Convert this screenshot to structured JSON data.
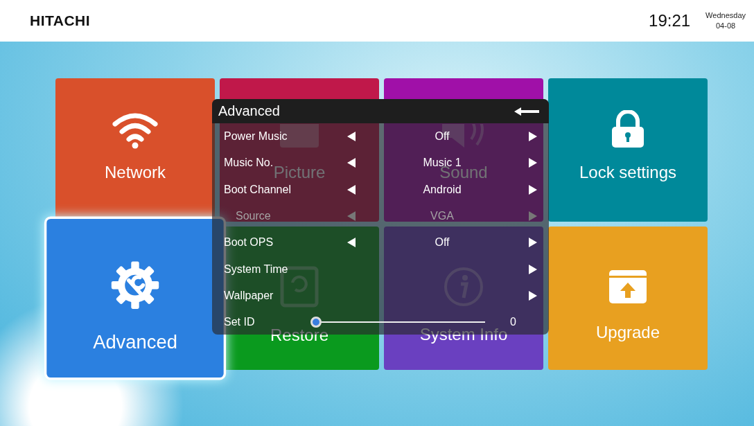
{
  "header": {
    "logo": "HITACHI",
    "time": "19:21",
    "weekday": "Wednesday",
    "date": "04-08"
  },
  "tiles": [
    {
      "label": "Network",
      "kind": "network",
      "color": "#d9502b",
      "selected": false
    },
    {
      "label": "Picture",
      "kind": "picture",
      "color": "#c0184a",
      "selected": false
    },
    {
      "label": "Sound",
      "kind": "sound",
      "color": "#a010a8",
      "selected": false
    },
    {
      "label": "Lock settings",
      "kind": "lock",
      "color": "#00899a",
      "selected": false
    },
    {
      "label": "Advanced",
      "kind": "advanced",
      "color": "#2b80e0",
      "selected": true
    },
    {
      "label": "Restore",
      "kind": "restore",
      "color": "#0a9a1e",
      "selected": false
    },
    {
      "label": "System Info",
      "kind": "info",
      "color": "#6a40c0",
      "selected": false
    },
    {
      "label": "Upgrade",
      "kind": "upgrade",
      "color": "#e8a020",
      "selected": false
    }
  ],
  "dialog": {
    "title": "Advanced",
    "rows": [
      {
        "kind": "option",
        "label": "Power Music",
        "value": "Off",
        "disabled": false
      },
      {
        "kind": "option",
        "label": "Music No.",
        "value": "Music 1",
        "disabled": false
      },
      {
        "kind": "option",
        "label": "Boot Channel",
        "value": "Android",
        "disabled": false
      },
      {
        "kind": "option",
        "label": "Source",
        "value": "VGA",
        "disabled": true
      },
      {
        "kind": "option",
        "label": "Boot OPS",
        "value": "Off",
        "disabled": false
      },
      {
        "kind": "link",
        "label": "System Time",
        "disabled": false
      },
      {
        "kind": "link",
        "label": "Wallpaper",
        "disabled": false
      },
      {
        "kind": "slider",
        "label": "Set ID",
        "value": "0",
        "level": 0,
        "disabled": false
      }
    ]
  }
}
